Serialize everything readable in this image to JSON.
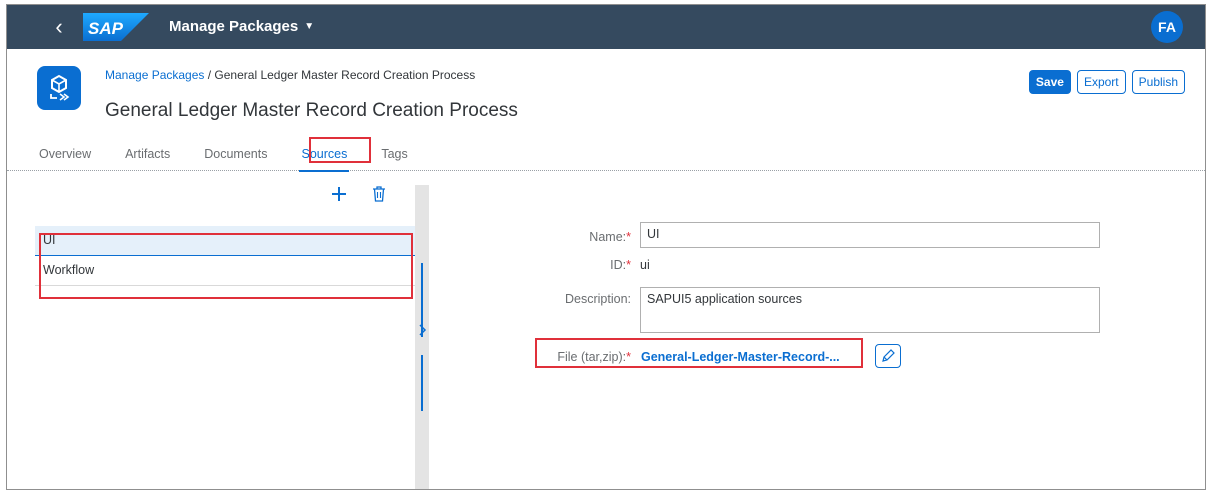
{
  "shell": {
    "back_label": "‹",
    "logo_text": "SAP",
    "title": "Manage Packages",
    "caret": "▼",
    "avatar_initials": "FA",
    "colors": {
      "shell_bg": "#354a5f",
      "accent": "#0a6ed1",
      "highlight": "#e0303a"
    }
  },
  "header": {
    "breadcrumb_link": "Manage Packages",
    "breadcrumb_separator": " / ",
    "breadcrumb_current": "General Ledger Master Record Creation Process",
    "title": "General Ledger Master Record Creation Process",
    "app_icon": "package-icon",
    "buttons": {
      "save": "Save",
      "export": "Export",
      "publish": "Publish"
    }
  },
  "tabs": [
    {
      "label": "Overview"
    },
    {
      "label": "Artifacts"
    },
    {
      "label": "Documents"
    },
    {
      "label": "Sources",
      "active": true
    },
    {
      "label": "Tags"
    }
  ],
  "master": {
    "add_icon": "add-icon",
    "delete_icon": "delete-icon",
    "items": [
      {
        "label": "UI",
        "selected": true
      },
      {
        "label": "Workflow",
        "selected": false
      }
    ]
  },
  "detail": {
    "name_label": "Name:",
    "name_value": "UI",
    "id_label": "ID:",
    "id_value": "ui",
    "description_label": "Description:",
    "description_value": "SAPUI5 application sources",
    "file_label": "File (tar,zip):",
    "file_value": "General-Ledger-Master-Record-...",
    "required_mark": "*",
    "edit_icon": "pencil-icon"
  }
}
